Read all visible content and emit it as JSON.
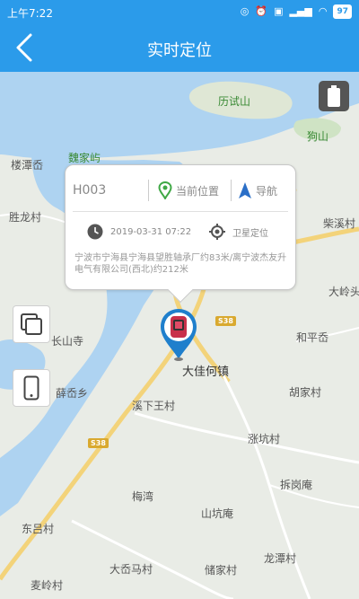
{
  "status_bar": {
    "time": "上午7:22",
    "battery": "97"
  },
  "header": {
    "title": "实时定位"
  },
  "popup": {
    "device_id": "H003",
    "current_position_label": "当前位置",
    "navigation_label": "导航",
    "datetime": "2019-03-31 07:22",
    "location_type": "卫星定位",
    "address": "宁波市宁海县宁海县望胜轴承厂约83米/离宁波杰友升电气有限公司(西北)约212米"
  },
  "map_labels": {
    "lishishan": "历试山",
    "goushan": "狗山",
    "weijiayu": "魏家屿",
    "loutanao": "楼潭岙",
    "shenglongcun": "胜龙村",
    "chaixicun": "柴溪村",
    "dalingtou": "大岭头",
    "changshansi": "长山寺",
    "hepingao": "和平岙",
    "xuaoxiang": "薛岙乡",
    "dajiahezhen": "大佳何镇",
    "xixiawangcun": "溪下王村",
    "hujiacun": "胡家村",
    "zhangkengcun": "涨坑村",
    "chaiganglao": "拆岗庵",
    "meiwan": "梅湾",
    "shankengan": "山坑庵",
    "donglvcun": "东吕村",
    "longtancun": "龙潭村",
    "daaomacun": "大岙马村",
    "chujiacun": "储家村",
    "mailingcun": "麦岭村",
    "road_s38_a": "S38",
    "road_s38_b": "S38"
  },
  "icons": {
    "back": "back-chevron-icon",
    "current_position": "location-pin-icon",
    "navigation": "navigation-arrow-icon",
    "clock": "clock-icon",
    "satellite": "satellite-target-icon",
    "layers": "map-layers-icon",
    "phone": "phone-icon",
    "battery_device": "battery-icon"
  },
  "colors": {
    "primary": "#2b9bea",
    "water": "#aed3f1",
    "land": "#e9ece6",
    "road": "#f3d37a"
  }
}
